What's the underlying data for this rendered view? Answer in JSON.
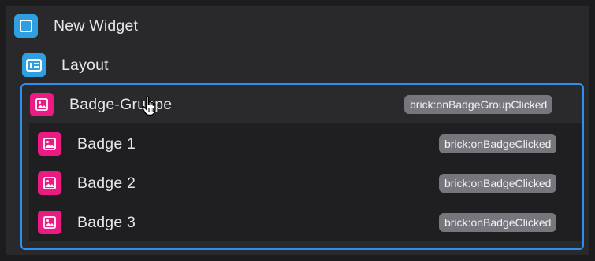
{
  "tree": {
    "root": {
      "label": "New Widget",
      "icon": "frame-icon"
    },
    "layout": {
      "label": "Layout",
      "icon": "layout-icon"
    },
    "group": {
      "label": "Badge-Gruppe",
      "icon": "image-icon",
      "event": "brick:onBadgeGroupClicked"
    },
    "children": [
      {
        "label": "Badge 1",
        "icon": "image-icon",
        "event": "brick:onBadgeClicked"
      },
      {
        "label": "Badge 2",
        "icon": "image-icon",
        "event": "brick:onBadgeClicked"
      },
      {
        "label": "Badge 3",
        "icon": "image-icon",
        "event": "brick:onBadgeClicked"
      }
    ]
  },
  "colors": {
    "background": "#29292c",
    "selection_border": "#2d8ff0",
    "blue_icon": "#2f9fe0",
    "pink_icon": "#ec1b84",
    "tag_bg": "#76767c"
  },
  "cursor": "hand-pointer-icon"
}
